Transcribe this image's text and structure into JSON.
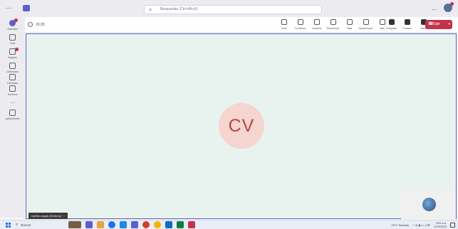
{
  "titlebar": {
    "search_placeholder": "Busquedas (Ctrl+Alt+E)",
    "more_label": "..."
  },
  "rail": {
    "items": [
      {
        "label": "Actividad",
        "icon": "bell-icon"
      },
      {
        "label": "Chat",
        "icon": "chat-icon"
      },
      {
        "label": "Equipos",
        "icon": "teams-icon"
      },
      {
        "label": "Calendario",
        "icon": "calendar-icon"
      },
      {
        "label": "Llamadas",
        "icon": "call-icon"
      },
      {
        "label": "Archivos",
        "icon": "files-icon"
      },
      {
        "label": "...",
        "icon": "more-icon"
      },
      {
        "label": "Aplicaciones",
        "icon": "apps-icon"
      }
    ]
  },
  "meeting": {
    "timer": "29:28",
    "tools": [
      {
        "label": "Chat",
        "icon": "chat-icon"
      },
      {
        "label": "Contactos",
        "icon": "people-icon"
      },
      {
        "label": "Levantar",
        "icon": "raise-hand-icon"
      },
      {
        "label": "Reaccionar",
        "icon": "react-icon"
      },
      {
        "label": "Vista",
        "icon": "view-icon"
      },
      {
        "label": "Aplicaciones",
        "icon": "apps-icon"
      },
      {
        "label": "Más",
        "icon": "more-icon"
      }
    ],
    "tools_right": [
      {
        "label": "Cámara",
        "icon": "camera-icon"
      },
      {
        "label": "Micro",
        "icon": "mic-icon"
      },
      {
        "label": "Compartir",
        "icon": "share-icon"
      }
    ],
    "leave_label": "Salir",
    "participant_initials": "CV",
    "participant_name": "camila vargas (Externo)"
  },
  "taskbar": {
    "search_label": "Buscar",
    "weather": "29°C Soleado",
    "time": "9:00 a.m.",
    "date": "10/10/2023"
  },
  "colors": {
    "accent": "#5b5fc7",
    "leave": "#c4314b",
    "stage_bg": "#e8f3ef",
    "avatar_bg": "#f6d4cf",
    "avatar_text": "#b24a40"
  }
}
